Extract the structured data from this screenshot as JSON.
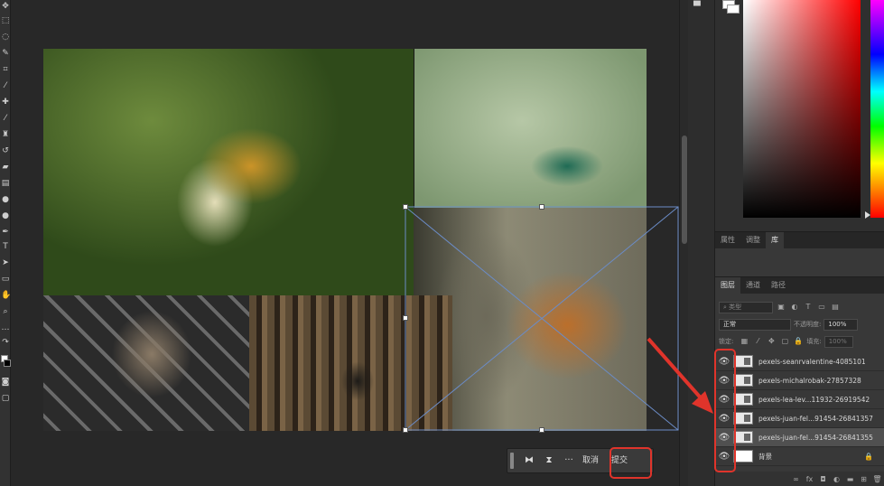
{
  "toolbar": {
    "tools": [
      "move-tool-icon",
      "marquee-tool-icon",
      "lasso-tool-icon",
      "quick-select-tool-icon",
      "crop-tool-icon",
      "frame-tool-icon",
      "eyedropper-tool-icon",
      "healing-tool-icon",
      "brush-tool-icon",
      "stamp-tool-icon",
      "history-brush-tool-icon",
      "eraser-tool-icon",
      "gradient-tool-icon",
      "blur-tool-icon",
      "dodge-tool-icon",
      "pen-tool-icon",
      "type-tool-icon",
      "path-select-tool-icon",
      "rectangle-tool-icon",
      "hand-tool-icon",
      "zoom-tool-icon",
      "more-tools-icon"
    ],
    "type_glyph": "T"
  },
  "transform_toolbar": {
    "cancel_label": "取消",
    "commit_label": "提交",
    "more_label": "···"
  },
  "color_panel": {
    "fg_color": "#ffffff",
    "bg_color": "#ffffff"
  },
  "tabs_top": [
    {
      "label": "属性",
      "active": false
    },
    {
      "label": "调整",
      "active": false
    },
    {
      "label": "库",
      "active": true
    }
  ],
  "tabs_layers": [
    {
      "label": "图层",
      "active": true
    },
    {
      "label": "通道",
      "active": false
    },
    {
      "label": "路径",
      "active": false
    }
  ],
  "layers_panel": {
    "filter_placeholder": "类型",
    "blend_mode": "正常",
    "opacity_label": "不透明度:",
    "opacity_value": "100%",
    "lock_label": "锁定:",
    "fill_label": "填充:",
    "fill_value": "100%",
    "layers": [
      {
        "name": "pexels-seanrvalentine-4085101",
        "visible": true,
        "selected": false
      },
      {
        "name": "pexels-michalrobak-27857328",
        "visible": true,
        "selected": false
      },
      {
        "name": "pexels-lea-lev...11932-26919542",
        "visible": true,
        "selected": false
      },
      {
        "name": "pexels-juan-fel...91454-26841357",
        "visible": true,
        "selected": false
      },
      {
        "name": "pexels-juan-fel...91454-26841355",
        "visible": true,
        "selected": true
      },
      {
        "name": "背景",
        "visible": true,
        "selected": false,
        "locked": true
      }
    ]
  },
  "annotation_color": "#e0342b",
  "accent_color": "#6b8cc7"
}
